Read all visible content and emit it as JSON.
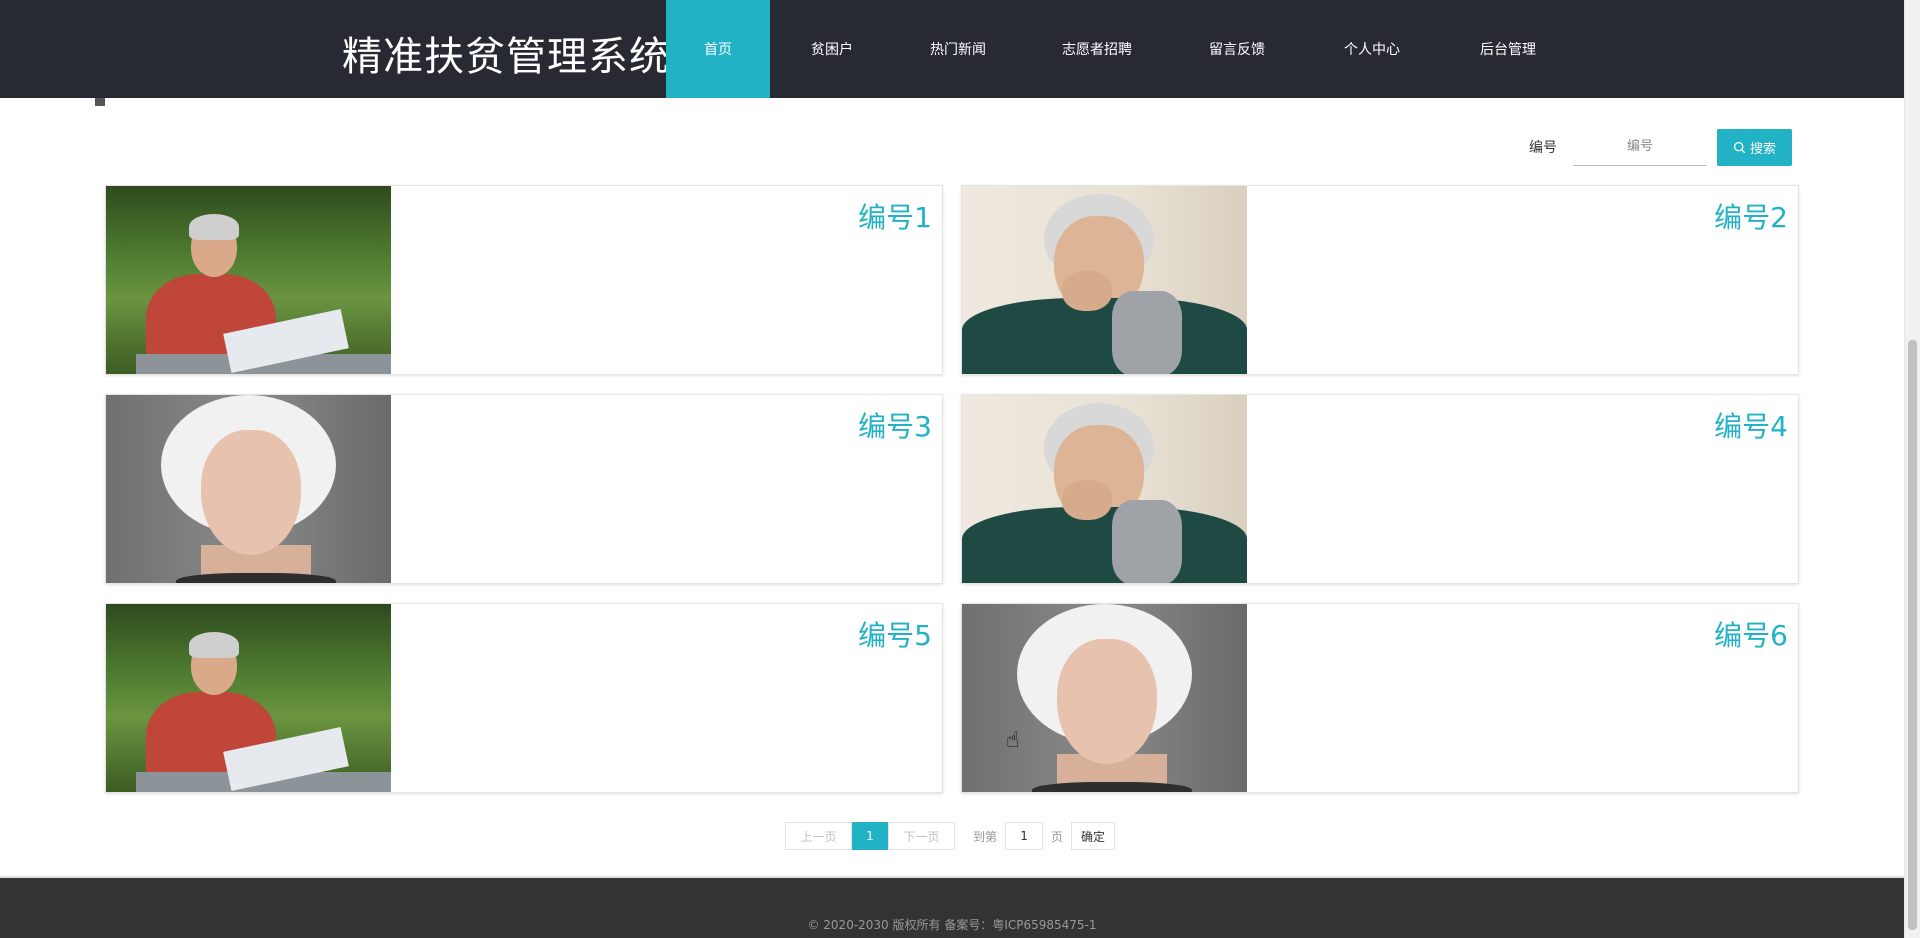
{
  "header": {
    "brand": "精准扶贫管理系统",
    "nav": [
      {
        "label": "首页",
        "active": true
      },
      {
        "label": "贫困户",
        "active": false
      },
      {
        "label": "热门新闻",
        "active": false
      },
      {
        "label": "志愿者招聘",
        "active": false
      },
      {
        "label": "留言反馈",
        "active": false
      },
      {
        "label": "个人中心",
        "active": false
      },
      {
        "label": "后台管理",
        "active": false
      }
    ]
  },
  "search": {
    "label": "编号",
    "placeholder": "编号",
    "button_label": "搜索",
    "button_icon": "search-icon"
  },
  "cards": [
    {
      "title": "编号1",
      "photo": "elderly-man-reading-newspaper"
    },
    {
      "title": "编号2",
      "photo": "elderly-woman-smiling"
    },
    {
      "title": "编号3",
      "photo": "elderly-woman-white-hair"
    },
    {
      "title": "编号4",
      "photo": "elderly-woman-smiling"
    },
    {
      "title": "编号5",
      "photo": "elderly-man-reading-newspaper"
    },
    {
      "title": "编号6",
      "photo": "elderly-woman-white-hair"
    }
  ],
  "pagination": {
    "prev_label": "上一页",
    "current_page": "1",
    "next_label": "下一页",
    "goto_prefix": "到第",
    "goto_value": "1",
    "goto_suffix": "页",
    "confirm_label": "确定"
  },
  "footer": {
    "text": "© 2020-2030 版权所有 备案号：粤ICP65985475-1"
  },
  "colors": {
    "accent": "#22b2c5",
    "header_bg": "#272a33",
    "footer_bg": "#333333"
  }
}
